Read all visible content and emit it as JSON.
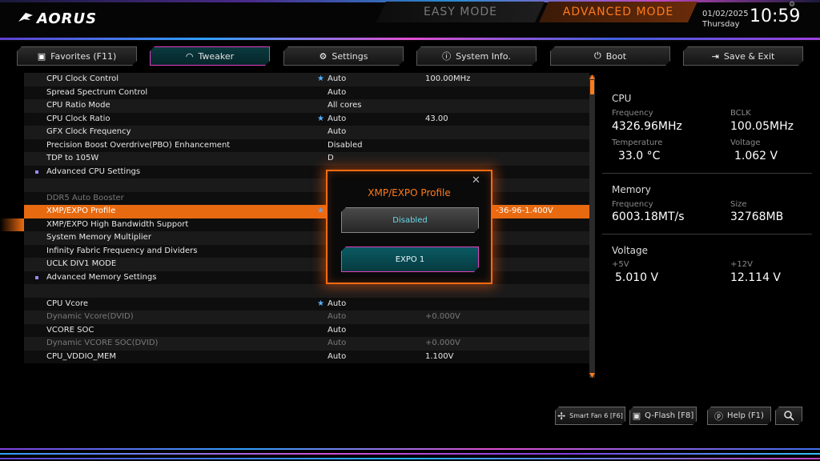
{
  "header": {
    "logo": "AORUS",
    "easy_mode": "EASY MODE",
    "advanced_mode": "ADVANCED MODE",
    "date": "01/02/2025",
    "day": "Thursday",
    "time": "10:59"
  },
  "tabs": [
    {
      "label": "Favorites (F11)",
      "icon": "favorites-icon"
    },
    {
      "label": "Tweaker",
      "icon": "gauge-icon",
      "active": true
    },
    {
      "label": "Settings",
      "icon": "gear-icon"
    },
    {
      "label": "System Info.",
      "icon": "info-icon"
    },
    {
      "label": "Boot",
      "icon": "power-icon"
    },
    {
      "label": "Save & Exit",
      "icon": "exit-icon"
    }
  ],
  "settings": [
    {
      "label": "CPU Clock Control",
      "star": true,
      "value": "Auto",
      "value2": "100.00MHz"
    },
    {
      "label": "Spread Spectrum Control",
      "value": "Auto"
    },
    {
      "label": "CPU Ratio Mode",
      "value": "All cores"
    },
    {
      "label": "CPU Clock Ratio",
      "star": true,
      "value": "Auto",
      "value2": "43.00"
    },
    {
      "label": "GFX Clock Frequency",
      "value": "Auto"
    },
    {
      "label": "Precision Boost Overdrive(PBO) Enhancement",
      "value": "Disabled"
    },
    {
      "label": "TDP to 105W",
      "value": "D"
    },
    {
      "label": "Advanced CPU Settings",
      "bullet": true
    },
    {
      "label": ""
    },
    {
      "label": "DDR5 Auto Booster",
      "dim": true
    },
    {
      "label": "XMP/EXPO Profile",
      "star": true,
      "value2": "-36-96-1.400V",
      "selected": true
    },
    {
      "label": "XMP/EXPO High Bandwidth Support"
    },
    {
      "label": "System Memory Multiplier"
    },
    {
      "label": "Infinity Fabric Frequency and Dividers"
    },
    {
      "label": "UCLK DIV1 MODE"
    },
    {
      "label": "Advanced Memory Settings",
      "bullet": true
    },
    {
      "label": ""
    },
    {
      "label": "CPU Vcore",
      "star": true,
      "value": "Auto"
    },
    {
      "label": "Dynamic Vcore(DVID)",
      "dim": true,
      "value": "Auto",
      "value2": "+0.000V"
    },
    {
      "label": "VCORE SOC",
      "value": "Auto"
    },
    {
      "label": "Dynamic VCORE SOC(DVID)",
      "dim": true,
      "value": "Auto",
      "value2": "+0.000V"
    },
    {
      "label": "CPU_VDDIO_MEM",
      "value": "Auto",
      "value2": "1.100V"
    }
  ],
  "info": {
    "cpu": {
      "title": "CPU",
      "frequency_label": "Frequency",
      "frequency": "4326.96MHz",
      "bclk_label": "BCLK",
      "bclk": "100.05MHz",
      "temperature_label": "Temperature",
      "temperature": "33.0 °C",
      "voltage_label": "Voltage",
      "voltage": "1.062 V"
    },
    "memory": {
      "title": "Memory",
      "frequency_label": "Frequency",
      "frequency": "6003.18MT/s",
      "size_label": "Size",
      "size": "32768MB"
    },
    "voltage": {
      "title": "Voltage",
      "v5_label": "+5V",
      "v5": "5.010 V",
      "v12_label": "+12V",
      "v12": "12.114 V"
    }
  },
  "popup": {
    "title": "XMP/EXPO Profile",
    "close": "✕",
    "options": [
      "Disabled",
      "EXPO 1"
    ],
    "selected": "EXPO 1"
  },
  "bottom_buttons": {
    "smart_fan": "Smart Fan 6 [F6]",
    "qflash": "Q-Flash [F8]",
    "help": "Help (F1)"
  },
  "colors": {
    "accent": "#ff7a1a",
    "selected_row": "#e86a10",
    "active_tab_border": "#e040c0",
    "star": "#58b0ff"
  }
}
